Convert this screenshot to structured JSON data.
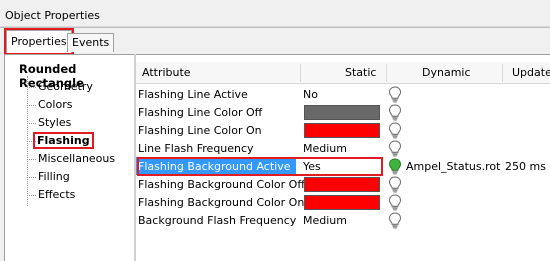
{
  "window": {
    "title": "Object Properties"
  },
  "tabs": [
    {
      "label": "Properties",
      "active": true
    },
    {
      "label": "Events",
      "active": false
    }
  ],
  "tree": {
    "root": "Rounded Rectangle",
    "items": [
      "Geometry",
      "Colors",
      "Styles",
      "Flashing",
      "Miscellaneous",
      "Filling",
      "Effects"
    ],
    "selected": "Flashing"
  },
  "grid": {
    "columns": [
      "Attribute",
      "Static",
      "Dynamic",
      "Update"
    ],
    "rows": [
      {
        "attribute": "Flashing Line Active",
        "static": "No",
        "static_color": "",
        "bulb": "off",
        "dynamic": "",
        "update": ""
      },
      {
        "attribute": "Flashing Line Color Off",
        "static": "",
        "static_color": "#696969",
        "bulb": "off",
        "dynamic": "",
        "update": ""
      },
      {
        "attribute": "Flashing Line Color On",
        "static": "",
        "static_color": "#ff0000",
        "bulb": "off",
        "dynamic": "",
        "update": ""
      },
      {
        "attribute": "Line Flash Frequency",
        "static": "Medium",
        "static_color": "",
        "bulb": "off",
        "dynamic": "",
        "update": ""
      },
      {
        "attribute": "Flashing Background Active",
        "static": "Yes",
        "static_color": "",
        "bulb": "on",
        "dynamic": "Ampel_Status.rot",
        "update": "250 ms",
        "selected": true
      },
      {
        "attribute": "Flashing Background Color Off",
        "static": "",
        "static_color": "#ff0000",
        "bulb": "off",
        "dynamic": "",
        "update": ""
      },
      {
        "attribute": "Flashing Background Color On",
        "static": "",
        "static_color": "#ff0000",
        "bulb": "off",
        "dynamic": "",
        "update": ""
      },
      {
        "attribute": "Background Flash Frequency",
        "static": "Medium",
        "static_color": "",
        "bulb": "off",
        "dynamic": "",
        "update": ""
      }
    ]
  },
  "colors": {
    "highlight_outline": "#e21b23",
    "selection": "#3399ff",
    "bulb_on": "#3db53d"
  }
}
